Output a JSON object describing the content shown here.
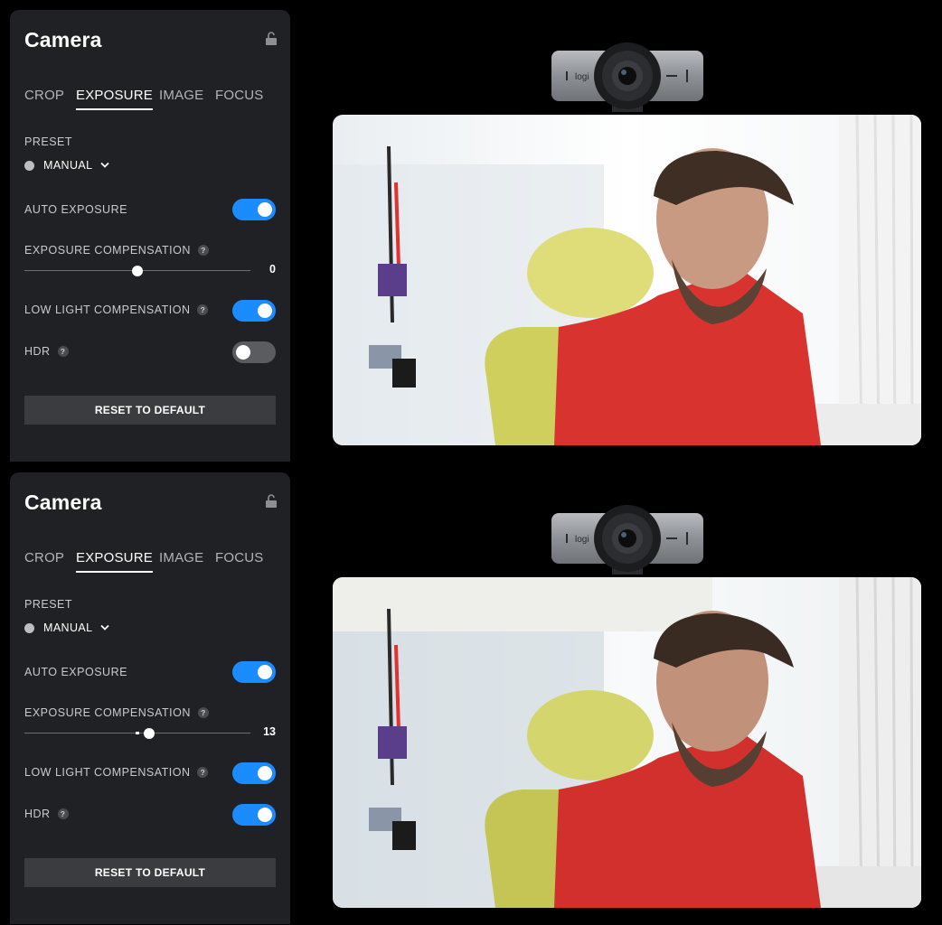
{
  "panels": [
    {
      "title": "Camera",
      "tabs": [
        "CROP",
        "EXPOSURE",
        "IMAGE",
        "FOCUS"
      ],
      "active_tab": "EXPOSURE",
      "preset_label": "PRESET",
      "preset_value": "MANUAL",
      "auto_exposure": {
        "label": "AUTO EXPOSURE",
        "state": "on"
      },
      "exposure_compensation": {
        "label": "EXPOSURE COMPENSATION",
        "value": "0",
        "position": 0.5
      },
      "low_light": {
        "label": "LOW LIGHT COMPENSATION",
        "state": "on"
      },
      "hdr": {
        "label": "HDR",
        "state": "off"
      },
      "help_glyph": "?",
      "reset_label": "RESET TO DEFAULT"
    },
    {
      "title": "Camera",
      "tabs": [
        "CROP",
        "EXPOSURE",
        "IMAGE",
        "FOCUS"
      ],
      "active_tab": "EXPOSURE",
      "preset_label": "PRESET",
      "preset_value": "MANUAL",
      "auto_exposure": {
        "label": "AUTO EXPOSURE",
        "state": "on"
      },
      "exposure_compensation": {
        "label": "EXPOSURE COMPENSATION",
        "value": "13",
        "position": 0.552
      },
      "low_light": {
        "label": "LOW LIGHT COMPENSATION",
        "state": "on"
      },
      "hdr": {
        "label": "HDR",
        "state": "on"
      },
      "help_glyph": "?",
      "reset_label": "RESET TO DEFAULT"
    }
  ],
  "webcam": {
    "brand": "logi"
  },
  "colors": {
    "accent": "#1a8cff",
    "panel": "#202124",
    "toggle_off": "#5b5c60"
  },
  "icons": {
    "lock": "unlocked-padlock-icon",
    "dropdown": "chevron-down-icon",
    "help": "question-circle-icon"
  }
}
